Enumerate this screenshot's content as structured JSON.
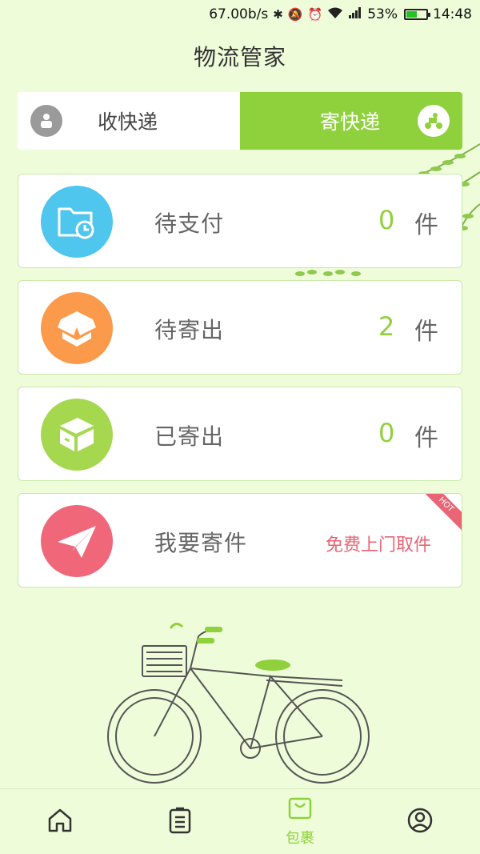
{
  "status_bar": {
    "network_speed": "67.00b/s",
    "battery_percent": "53%",
    "time": "14:48",
    "icons": [
      "bluetooth-icon",
      "mute-icon",
      "alarm-icon",
      "wifi-icon",
      "signal-icon",
      "battery-icon"
    ],
    "battery_level": 0.53
  },
  "header": {
    "title": "物流管家"
  },
  "tabs": [
    {
      "label": "收快递",
      "icon": "courier-person-icon",
      "active": false
    },
    {
      "label": "寄快递",
      "icon": "delivery-scooter-icon",
      "active": true
    }
  ],
  "cards": [
    {
      "label": "待支付",
      "count": "0",
      "unit": "件",
      "icon": "folder-clock-icon",
      "color": "#4ec6ee"
    },
    {
      "label": "待寄出",
      "count": "2",
      "unit": "件",
      "icon": "open-box-icon",
      "color": "#fb9a4a"
    },
    {
      "label": "已寄出",
      "count": "0",
      "unit": "件",
      "icon": "closed-box-icon",
      "color": "#a5d84f"
    },
    {
      "label": "我要寄件",
      "promo": "免费上门取件",
      "badge": "HOT",
      "icon": "paper-plane-icon",
      "color": "#f0677a"
    }
  ],
  "bottom_nav": [
    {
      "icon": "home-icon",
      "label": ""
    },
    {
      "icon": "list-icon",
      "label": ""
    },
    {
      "icon": "bag-icon",
      "label": "包裹",
      "active": true
    },
    {
      "icon": "user-icon",
      "label": ""
    }
  ],
  "colors": {
    "accent": "#8fd13c",
    "background": "#eefcd9",
    "promo": "#e96474"
  }
}
